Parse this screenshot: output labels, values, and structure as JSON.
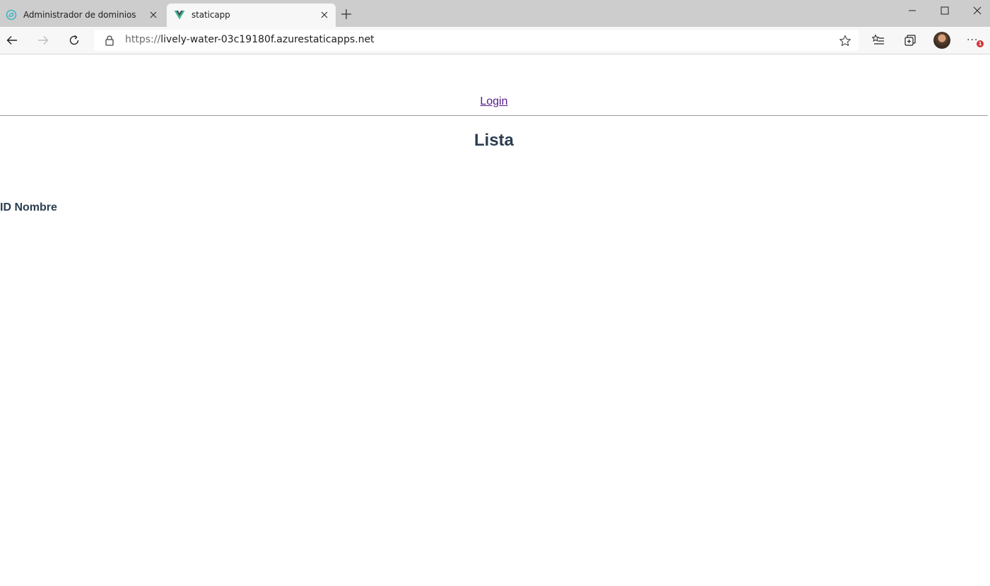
{
  "browser": {
    "tabs": [
      {
        "title": "Administrador de dominios",
        "favicon": "domain-admin-icon",
        "active": false
      },
      {
        "title": "staticapp",
        "favicon": "vue-logo-icon",
        "active": true
      }
    ],
    "address": {
      "scheme": "https://",
      "host": "lively-water-03c19180f.azurestaticapps.net"
    },
    "notification_badge": "1",
    "colors": {
      "tabstrip": "#cdcdcd",
      "toolbar": "#f7f7f7",
      "badge": "#d13438",
      "vue_green": "#41b883",
      "vue_dark": "#35495e"
    }
  },
  "page": {
    "nav": {
      "login_label": "Login"
    },
    "title": "Lista",
    "table": {
      "headers": [
        "ID",
        "Nombre"
      ]
    },
    "colors": {
      "text": "#2c3e50",
      "link_visited": "#551a8b"
    }
  }
}
